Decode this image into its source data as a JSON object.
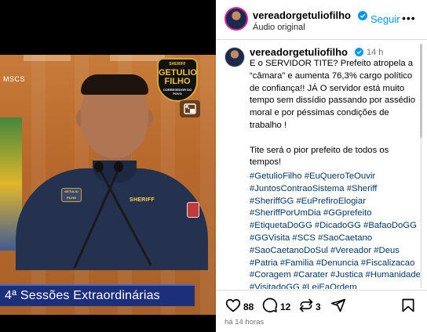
{
  "video": {
    "corner_label": "MSCS",
    "logo": {
      "line1": "SHERIFF",
      "line2": "GETULIO",
      "line3": "FILHO",
      "line4": "CORREGEDOR DO POVO"
    },
    "patch_chest": "SHERIFF",
    "patch_left": "GETULIO FILHO",
    "banner_text": "4ª Sessões Extraordinárias"
  },
  "header": {
    "username": "vereadorgetuliofilho",
    "subtitle": "Áudio original",
    "follow_label": "Seguir",
    "more": "•••"
  },
  "post": {
    "username": "vereadorgetuliofilho",
    "time": "14 h",
    "paragraph1": "E o SERVIDOR TITE? Prefeito atropela a “câmara” e aumenta 76,3% cargo político de confiança!! JÁ O servidor está muito tempo sem dissídio passando por assédio moral e por péssimas condições de trabalho !",
    "paragraph2": "Tite será o pior prefeito de todos os tempos!",
    "hashtags": "#GetulioFilho #EuQueroTeOuvir #JuntosContraoSistema #Sheriff #SheriffGG #EuPrefiroElogiar #SheriffPorUmDia #GGprefeito #EtiquetaDoGG #DicadoGG #BafaoDoGG #GGVisita #SCS #SaoCaetano #SaoCaetanoDoSul #Vereador #Deus #Patria #Familia #Denuncia #Fiscalizacao #Coragem #Carater #Justica #Humanidade #VisitadoGG #LeiEaOrdem #UmContraTodos #BalancaSheriffGG"
  },
  "actions": {
    "likes": "88",
    "comments": "12",
    "shares": "3",
    "timestamp": "há 14 horas"
  },
  "colors": {
    "link": "#00376b",
    "follow": "#0095f6",
    "verified": "#0095f6",
    "banner": "#1b2f7a"
  }
}
